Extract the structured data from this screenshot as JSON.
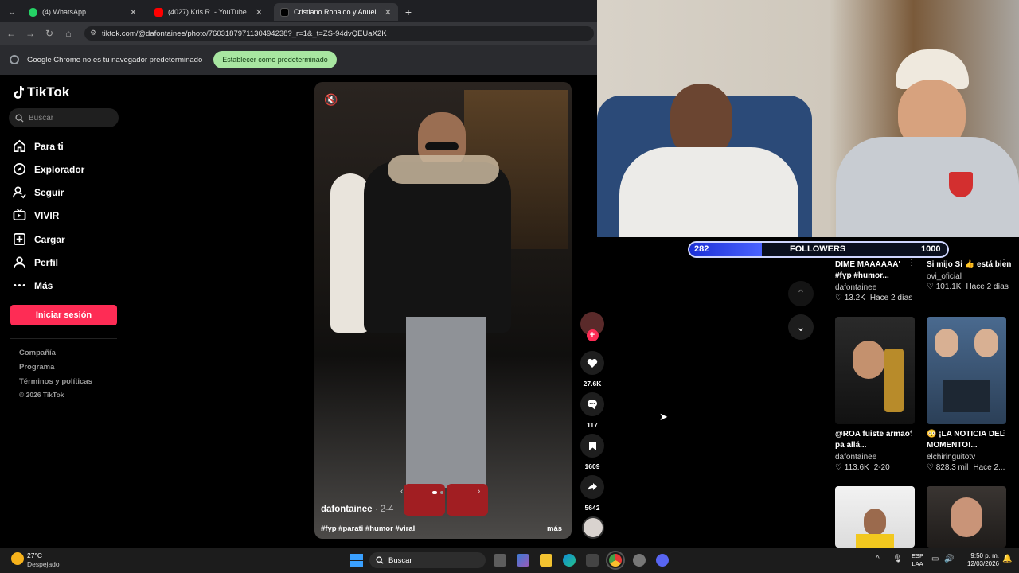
{
  "browser": {
    "tabs": [
      {
        "label": "(4) WhatsApp",
        "icon": "whatsapp-icon"
      },
      {
        "label": "(4027) Kris R. - YouTube",
        "icon": "youtube-icon"
      },
      {
        "label": "Cristiano Ronaldo y Anuel AA | ",
        "icon": "tiktok-icon"
      }
    ],
    "new_tab": "+",
    "url": "tiktok.com/@dafontainee/photo/7603187971130494238?_r=1&_t=ZS-94dvQEUaX2K",
    "infobar_text": "Google Chrome no es tu navegador predeterminado",
    "infobar_button": "Establecer como predeterminado"
  },
  "tiktok": {
    "logo": "TikTok",
    "search_placeholder": "Buscar",
    "nav": [
      {
        "label": "Para ti",
        "icon": "home-icon"
      },
      {
        "label": "Explorador",
        "icon": "compass-icon"
      },
      {
        "label": "Seguir",
        "icon": "following-icon"
      },
      {
        "label": "VIVIR",
        "icon": "live-icon"
      },
      {
        "label": "Cargar",
        "icon": "upload-icon"
      },
      {
        "label": "Perfil",
        "icon": "profile-icon"
      },
      {
        "label": "Más",
        "icon": "more-icon"
      }
    ],
    "login": "Iniciar sesión",
    "footer": [
      "Compañía",
      "Programa",
      "Términos y políticas",
      "© 2026 TikTok"
    ]
  },
  "post": {
    "author": "dafontainee",
    "date": "· 2-4",
    "caption": "#fyp #parati #humor #viral",
    "more": "más",
    "likes": "27.6K",
    "comments": "117",
    "saves": "1609",
    "shares": "5642",
    "plus": "+"
  },
  "stream": {
    "followers_count": "282",
    "followers_label": "FOLLOWERS",
    "followers_goal": "1000",
    "followers_progress": 0.282
  },
  "grid": [
    {
      "title": "DIME MAAAAAA' #fyp #humor...",
      "user": "dafontainee",
      "likes": "13.2K",
      "when": "Hace 2 días"
    },
    {
      "title": "Si mijo Si 👍 está bien",
      "user": "ovi_oficial",
      "likes": "101.1K",
      "when": "Hace 2 días"
    },
    {
      "title": "@ROA fuiste armao' pa allá...",
      "user": "dafontainee",
      "likes": "113.6K",
      "when": "2-20"
    },
    {
      "title": "😳 ¡LA NOTICIA DEL MOMENTO!...",
      "user": "elchiringuitotv",
      "likes": "828.3 mil",
      "when": "Hace 2..."
    }
  ],
  "taskbar": {
    "weather_temp": "27°C",
    "weather_desc": "Despejado",
    "search": "Buscar",
    "lang1": "ESP",
    "lang2": "LAA",
    "time": "9:50 p. m.",
    "date": "12/03/2026"
  },
  "colors": {
    "tiktok_red": "#fe2c55",
    "chrome_green": "#a8e6a1"
  }
}
